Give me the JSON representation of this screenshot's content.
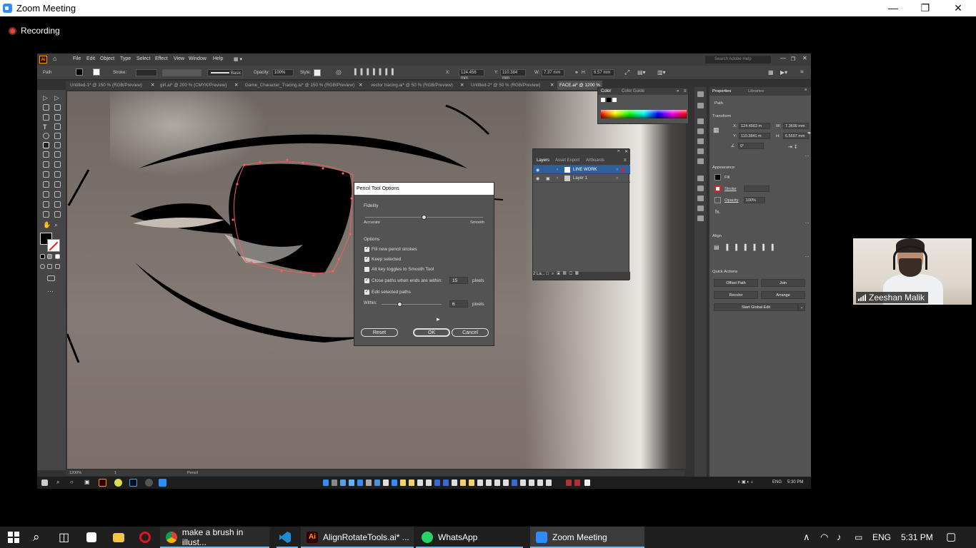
{
  "zoom": {
    "title": "Zoom Meeting",
    "recording_label": "Recording",
    "participant_name": "Zeeshan Malik"
  },
  "illustrator": {
    "menu": [
      "File",
      "Edit",
      "Object",
      "Type",
      "Select",
      "Effect",
      "View",
      "Window",
      "Help"
    ],
    "search_placeholder": "Search Adobe Help",
    "control_bar": {
      "selection_label": "Path",
      "stroke_label": "Stroke:",
      "brush_label": "Basic",
      "opacity_label": "Opacity:",
      "opacity_value": "100%",
      "style_label": "Style:",
      "x_label": "X:",
      "x_value": "124.456 mm",
      "y_label": "Y:",
      "y_value": "110.384 mm",
      "w_label": "W:",
      "w_value": "7.37 mm",
      "h_label": "H:",
      "h_value": "6.57 mm"
    },
    "doc_tabs": [
      "Untitled-1* @ 150 % (RGB/Preview)",
      "girl.ai* @ 200 % (CMYK/Preview)",
      "Game_Character_Tracing.ai* @ 150 % (RGB/Preview)",
      "vector tracing.ai* @ 50 % (RGB/Preview)",
      "Untitled-2* @ 50 % (RGB/Preview)",
      "FACE.ai* @ 1200 %"
    ],
    "color_panel": {
      "tabs": [
        "Color",
        "Color Guide"
      ]
    },
    "layers_panel": {
      "tabs": [
        "Layers",
        "Asset Export",
        "Artboards"
      ],
      "rows": [
        "LINE WORK",
        "Layer 1"
      ],
      "footer": "2 La..."
    },
    "properties_panel": {
      "tabs": [
        "Properties",
        "Libraries"
      ],
      "selection": "Path",
      "transform_title": "Transform",
      "x_label": "X:",
      "x_value": "124.4563 m",
      "y_label": "Y:",
      "y_value": "110.3841 m",
      "w_label": "W:",
      "w_value": "7.3699 mm",
      "h_label": "H:",
      "h_value": "6.5697 mm",
      "angle_value": "0°",
      "appearance_title": "Appearance",
      "fill_label": "Fill",
      "stroke_label": "Stroke",
      "opacity_label": "Opacity",
      "opacity_value": "100%",
      "align_title": "Align",
      "quick_actions_title": "Quick Actions",
      "buttons": [
        "Offset Path",
        "Join",
        "Recolor",
        "Arrange",
        "Start Global Edit"
      ]
    },
    "status_bar": {
      "zoom": "1200%",
      "artboard": "1",
      "tool": "Pencil"
    },
    "inner_clock": "5:30 PM",
    "inner_lang": "ENG",
    "pencil_dialog": {
      "title": "Pencil Tool Options",
      "fidelity_label": "Fidelity",
      "fidelity_left": "Accurate",
      "fidelity_right": "Smooth",
      "options_label": "Options",
      "checkboxes": [
        {
          "label": "Fill new pencil strokes",
          "checked": true
        },
        {
          "label": "Keep selected",
          "checked": true
        },
        {
          "label": "Alt key toggles to Smooth Tool",
          "checked": false
        },
        {
          "label": "Close paths when ends are within:",
          "checked": true
        },
        {
          "label": "Edit selected paths",
          "checked": true
        }
      ],
      "close_paths_value": "15",
      "close_paths_unit": "pixels",
      "within_label": "Within:",
      "within_value": "6",
      "within_unit": "pixels",
      "reset_label": "Reset",
      "ok_label": "OK",
      "cancel_label": "Cancel"
    }
  },
  "taskbar": {
    "items": [
      {
        "label": "make a brush in illust...",
        "icon": "chrome-icon"
      },
      {
        "label": "",
        "icon": "vscode-icon"
      },
      {
        "label": "AlignRotateTools.ai* ...",
        "icon": "illustrator-icon"
      },
      {
        "label": "WhatsApp",
        "icon": "whatsapp-icon"
      },
      {
        "label": "Zoom Meeting",
        "icon": "zoom-icon"
      }
    ],
    "lang": "ENG",
    "time": "5:31 PM"
  }
}
